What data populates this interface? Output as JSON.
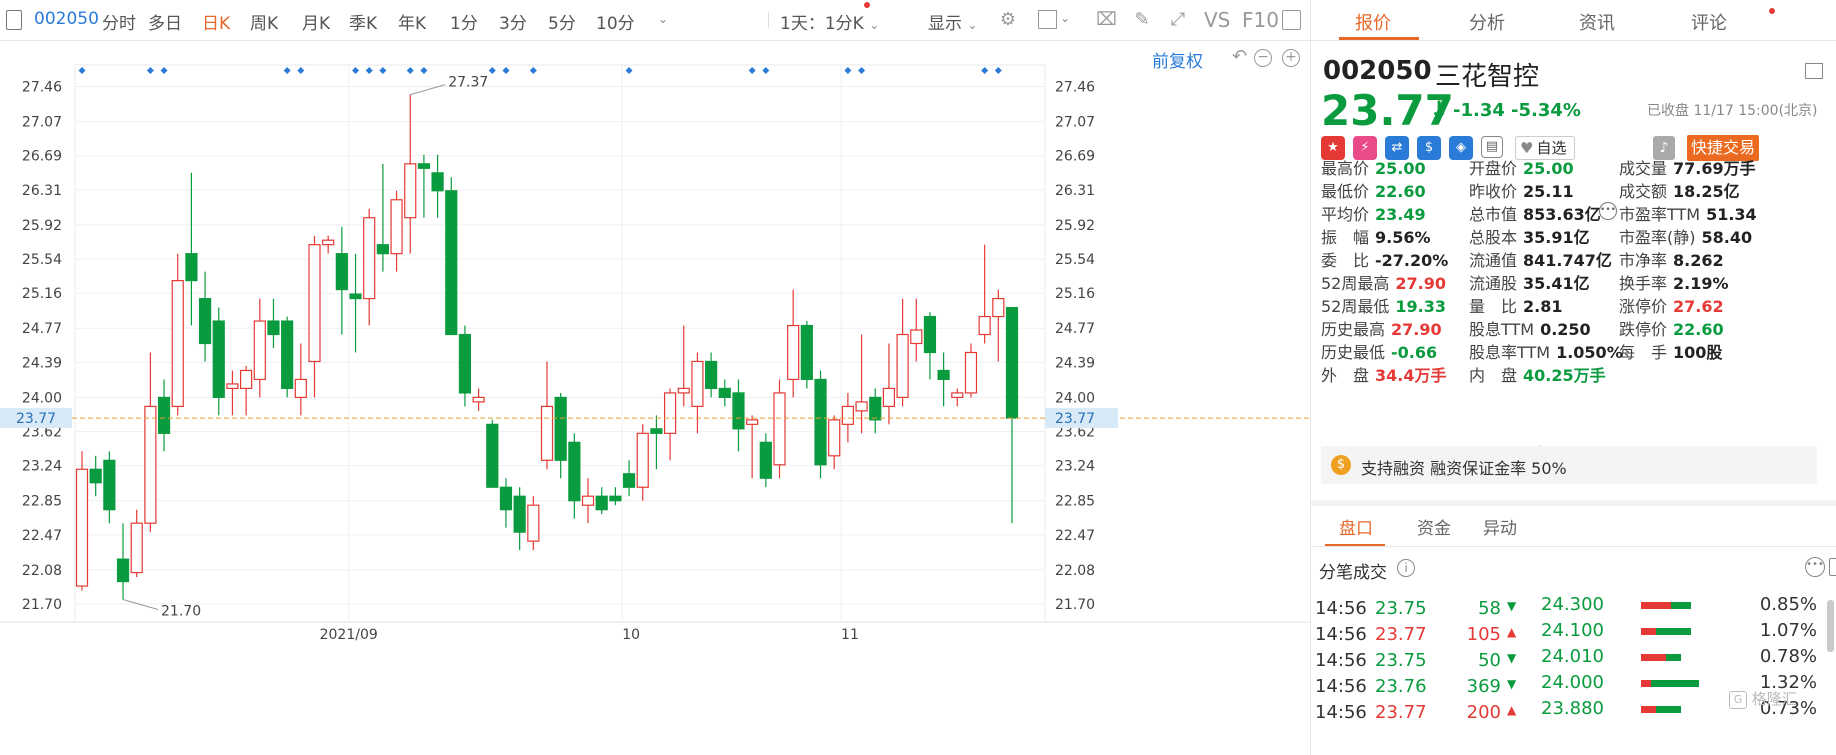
{
  "toolbar": {
    "code": "002050",
    "periods": [
      "分时",
      "多日",
      "日K",
      "周K",
      "月K",
      "季K",
      "年K",
      "1分",
      "3分",
      "5分",
      "10分"
    ],
    "active_period": "日K",
    "range_select": "1天：1分K",
    "display_label": "显示",
    "vs_label": "VS",
    "f10_label": "F10"
  },
  "chart": {
    "adjust_label": "前复权",
    "y_ticks": [
      "27.46",
      "27.07",
      "26.69",
      "26.31",
      "25.92",
      "25.54",
      "25.16",
      "24.77",
      "24.39",
      "24.00",
      "23.62",
      "23.24",
      "22.85",
      "22.47",
      "22.08",
      "21.70"
    ],
    "x_labels": [
      "2021/09",
      "10",
      "11"
    ],
    "high_label": "27.37",
    "low_label": "21.70",
    "current_price_label": "23.77",
    "up_color": "#e53935",
    "down_color": "#0b9b3f"
  },
  "tabs": [
    "报价",
    "分析",
    "资讯",
    "评论"
  ],
  "active_tab": "报价",
  "quote": {
    "code": "002050",
    "name": "三花智控",
    "price": "23.77",
    "change": "-1.34",
    "change_pct": "-5.34%",
    "status": "已收盘 11/17 15:00(北京)",
    "watchlist_label": "自选",
    "quick_trade_label": "快捷交易"
  },
  "stats": [
    [
      {
        "label": "最高价",
        "value": "25.00",
        "color": "green"
      },
      {
        "label": "开盘价",
        "value": "25.00",
        "color": "green"
      },
      {
        "label": "成交量",
        "value": "77.69万手",
        "color": ""
      }
    ],
    [
      {
        "label": "最低价",
        "value": "22.60",
        "color": "green"
      },
      {
        "label": "昨收价",
        "value": "25.11",
        "color": ""
      },
      {
        "label": "成交额",
        "value": "18.25亿",
        "color": ""
      }
    ],
    [
      {
        "label": "平均价",
        "value": "23.49",
        "color": "green"
      },
      {
        "label": "总市值",
        "value": "853.63亿",
        "color": ""
      },
      {
        "label": "市盈率TTM",
        "value": "51.34",
        "color": ""
      }
    ],
    [
      {
        "label": "振　幅",
        "value": "9.56%",
        "color": ""
      },
      {
        "label": "总股本",
        "value": "35.91亿",
        "color": ""
      },
      {
        "label": "市盈率(静)",
        "value": "58.40",
        "color": ""
      }
    ],
    [
      {
        "label": "委　比",
        "value": "-27.20%",
        "color": ""
      },
      {
        "label": "流通值",
        "value": "841.747亿",
        "color": ""
      },
      {
        "label": "市净率",
        "value": "8.262",
        "color": ""
      }
    ],
    [
      {
        "label": "52周最高",
        "value": "27.90",
        "color": "red"
      },
      {
        "label": "流通股",
        "value": "35.41亿",
        "color": ""
      },
      {
        "label": "换手率",
        "value": "2.19%",
        "color": ""
      }
    ],
    [
      {
        "label": "52周最低",
        "value": "19.33",
        "color": "green"
      },
      {
        "label": "量　比",
        "value": "2.81",
        "color": ""
      },
      {
        "label": "涨停价",
        "value": "27.62",
        "color": "red"
      }
    ],
    [
      {
        "label": "历史最高",
        "value": "27.90",
        "color": "red"
      },
      {
        "label": "股息TTM",
        "value": "0.250",
        "color": ""
      },
      {
        "label": "跌停价",
        "value": "22.60",
        "color": "green"
      }
    ],
    [
      {
        "label": "历史最低",
        "value": "-0.66",
        "color": "green"
      },
      {
        "label": "股息率TTM",
        "value": "1.050%",
        "color": ""
      },
      {
        "label": "每　手",
        "value": "100股",
        "color": ""
      }
    ],
    [
      {
        "label": "外　盘",
        "value": "34.4万手",
        "color": "red"
      },
      {
        "label": "内　盘",
        "value": "40.25万手",
        "color": "green"
      },
      {
        "label": "",
        "value": "",
        "color": ""
      }
    ]
  ],
  "margin_text": "支持融资 融资保证金率 50%",
  "subtabs": [
    "盘口",
    "资金",
    "异动"
  ],
  "active_subtab": "盘口",
  "ticks_title": "分笔成交",
  "ticks": [
    {
      "time": "14:56",
      "price": "23.75",
      "vol": "58",
      "dir": "down"
    },
    {
      "time": "14:56",
      "price": "23.77",
      "vol": "105",
      "dir": "up"
    },
    {
      "time": "14:56",
      "price": "23.75",
      "vol": "50",
      "dir": "down"
    },
    {
      "time": "14:56",
      "price": "23.76",
      "vol": "369",
      "dir": "down"
    },
    {
      "time": "14:56",
      "price": "23.77",
      "vol": "200",
      "dir": "up"
    }
  ],
  "dist": [
    {
      "price": "24.300",
      "pct": "0.85%",
      "red": 0.6,
      "green": 0.4
    },
    {
      "price": "24.100",
      "pct": "1.07%",
      "red": 0.3,
      "green": 0.7
    },
    {
      "price": "24.010",
      "pct": "0.78%",
      "red": 0.5,
      "green": 0.3
    },
    {
      "price": "24.000",
      "pct": "1.32%",
      "red": 0.2,
      "green": 0.95
    },
    {
      "price": "23.880",
      "pct": "0.73%",
      "red": 0.3,
      "green": 0.5
    }
  ],
  "watermark": "格隆汇",
  "chart_data": {
    "type": "candlestick",
    "ylim": [
      21.5,
      27.7
    ],
    "current": 23.77,
    "candles": [
      {
        "o": 21.9,
        "h": 23.4,
        "l": 21.85,
        "c": 23.2
      },
      {
        "o": 23.2,
        "h": 23.35,
        "l": 22.9,
        "c": 23.05
      },
      {
        "o": 23.3,
        "h": 23.4,
        "l": 22.6,
        "c": 22.75
      },
      {
        "o": 22.2,
        "h": 22.6,
        "l": 21.75,
        "c": 21.95
      },
      {
        "o": 22.05,
        "h": 22.75,
        "l": 22.0,
        "c": 22.6
      },
      {
        "o": 22.6,
        "h": 24.5,
        "l": 22.5,
        "c": 23.9
      },
      {
        "o": 24.0,
        "h": 24.2,
        "l": 23.4,
        "c": 23.6
      },
      {
        "o": 23.9,
        "h": 25.6,
        "l": 23.8,
        "c": 25.3
      },
      {
        "o": 25.6,
        "h": 26.5,
        "l": 24.8,
        "c": 25.3
      },
      {
        "o": 25.1,
        "h": 25.4,
        "l": 24.4,
        "c": 24.6
      },
      {
        "o": 24.85,
        "h": 25.0,
        "l": 23.8,
        "c": 24.0
      },
      {
        "o": 24.1,
        "h": 24.3,
        "l": 23.8,
        "c": 24.15
      },
      {
        "o": 24.1,
        "h": 24.35,
        "l": 23.8,
        "c": 24.3
      },
      {
        "o": 24.2,
        "h": 25.1,
        "l": 24.0,
        "c": 24.85
      },
      {
        "o": 24.85,
        "h": 25.1,
        "l": 24.55,
        "c": 24.7
      },
      {
        "o": 24.85,
        "h": 24.9,
        "l": 24.0,
        "c": 24.1
      },
      {
        "o": 24.0,
        "h": 24.6,
        "l": 23.8,
        "c": 24.2
      },
      {
        "o": 24.4,
        "h": 25.8,
        "l": 24.0,
        "c": 25.7
      },
      {
        "o": 25.7,
        "h": 25.8,
        "l": 25.6,
        "c": 25.75
      },
      {
        "o": 25.6,
        "h": 25.9,
        "l": 24.7,
        "c": 25.2
      },
      {
        "o": 25.15,
        "h": 25.6,
        "l": 24.5,
        "c": 25.1
      },
      {
        "o": 25.1,
        "h": 26.1,
        "l": 24.8,
        "c": 26.0
      },
      {
        "o": 25.7,
        "h": 26.6,
        "l": 25.4,
        "c": 25.6
      },
      {
        "o": 25.6,
        "h": 26.3,
        "l": 25.4,
        "c": 26.2
      },
      {
        "o": 26.0,
        "h": 27.37,
        "l": 25.6,
        "c": 26.6
      },
      {
        "o": 26.6,
        "h": 26.7,
        "l": 26.0,
        "c": 26.55
      },
      {
        "o": 26.5,
        "h": 26.7,
        "l": 26.0,
        "c": 26.3
      },
      {
        "o": 26.3,
        "h": 26.45,
        "l": 24.7,
        "c": 24.7
      },
      {
        "o": 24.7,
        "h": 24.8,
        "l": 23.9,
        "c": 24.05
      },
      {
        "o": 23.95,
        "h": 24.1,
        "l": 23.85,
        "c": 24.0
      },
      {
        "o": 23.7,
        "h": 23.75,
        "l": 23.0,
        "c": 23.0
      },
      {
        "o": 23.0,
        "h": 23.1,
        "l": 22.55,
        "c": 22.75
      },
      {
        "o": 22.9,
        "h": 23.0,
        "l": 22.3,
        "c": 22.5
      },
      {
        "o": 22.4,
        "h": 22.9,
        "l": 22.3,
        "c": 22.8
      },
      {
        "o": 23.3,
        "h": 24.4,
        "l": 23.2,
        "c": 23.9
      },
      {
        "o": 24.0,
        "h": 24.05,
        "l": 23.1,
        "c": 23.3
      },
      {
        "o": 23.5,
        "h": 23.6,
        "l": 22.65,
        "c": 22.85
      },
      {
        "o": 22.8,
        "h": 23.1,
        "l": 22.6,
        "c": 22.9
      },
      {
        "o": 22.9,
        "h": 23.0,
        "l": 22.7,
        "c": 22.75
      },
      {
        "o": 22.9,
        "h": 23.0,
        "l": 22.8,
        "c": 22.85
      },
      {
        "o": 23.15,
        "h": 23.3,
        "l": 22.9,
        "c": 23.0
      },
      {
        "o": 23.0,
        "h": 23.7,
        "l": 22.85,
        "c": 23.6
      },
      {
        "o": 23.65,
        "h": 23.8,
        "l": 23.2,
        "c": 23.6
      },
      {
        "o": 23.6,
        "h": 24.1,
        "l": 23.3,
        "c": 24.05
      },
      {
        "o": 24.05,
        "h": 24.8,
        "l": 23.9,
        "c": 24.1
      },
      {
        "o": 23.9,
        "h": 24.5,
        "l": 23.6,
        "c": 24.4
      },
      {
        "o": 24.4,
        "h": 24.5,
        "l": 24.0,
        "c": 24.1
      },
      {
        "o": 24.1,
        "h": 24.2,
        "l": 23.9,
        "c": 24.0
      },
      {
        "o": 24.05,
        "h": 24.2,
        "l": 23.4,
        "c": 23.65
      },
      {
        "o": 23.7,
        "h": 23.8,
        "l": 23.1,
        "c": 23.75
      },
      {
        "o": 23.5,
        "h": 23.6,
        "l": 23.0,
        "c": 23.1
      },
      {
        "o": 23.25,
        "h": 24.2,
        "l": 23.1,
        "c": 24.05
      },
      {
        "o": 24.2,
        "h": 25.2,
        "l": 24.0,
        "c": 24.8
      },
      {
        "o": 24.8,
        "h": 24.85,
        "l": 24.1,
        "c": 24.2
      },
      {
        "o": 24.2,
        "h": 24.3,
        "l": 23.1,
        "c": 23.25
      },
      {
        "o": 23.35,
        "h": 23.8,
        "l": 23.2,
        "c": 23.75
      },
      {
        "o": 23.7,
        "h": 24.05,
        "l": 23.5,
        "c": 23.9
      },
      {
        "o": 23.85,
        "h": 24.7,
        "l": 23.6,
        "c": 23.95
      },
      {
        "o": 24.0,
        "h": 24.1,
        "l": 23.6,
        "c": 23.75
      },
      {
        "o": 23.9,
        "h": 24.6,
        "l": 23.7,
        "c": 24.1
      },
      {
        "o": 24.0,
        "h": 25.1,
        "l": 23.9,
        "c": 24.7
      },
      {
        "o": 24.6,
        "h": 25.1,
        "l": 24.4,
        "c": 24.75
      },
      {
        "o": 24.9,
        "h": 24.95,
        "l": 24.2,
        "c": 24.5
      },
      {
        "o": 24.3,
        "h": 24.5,
        "l": 23.9,
        "c": 24.2
      },
      {
        "o": 24.0,
        "h": 24.1,
        "l": 23.9,
        "c": 24.05
      },
      {
        "o": 24.05,
        "h": 24.6,
        "l": 24.0,
        "c": 24.5
      },
      {
        "o": 24.7,
        "h": 25.7,
        "l": 24.6,
        "c": 24.9
      },
      {
        "o": 24.9,
        "h": 25.2,
        "l": 24.4,
        "c": 25.1
      },
      {
        "o": 25.0,
        "h": 25.0,
        "l": 22.6,
        "c": 23.77
      }
    ]
  }
}
